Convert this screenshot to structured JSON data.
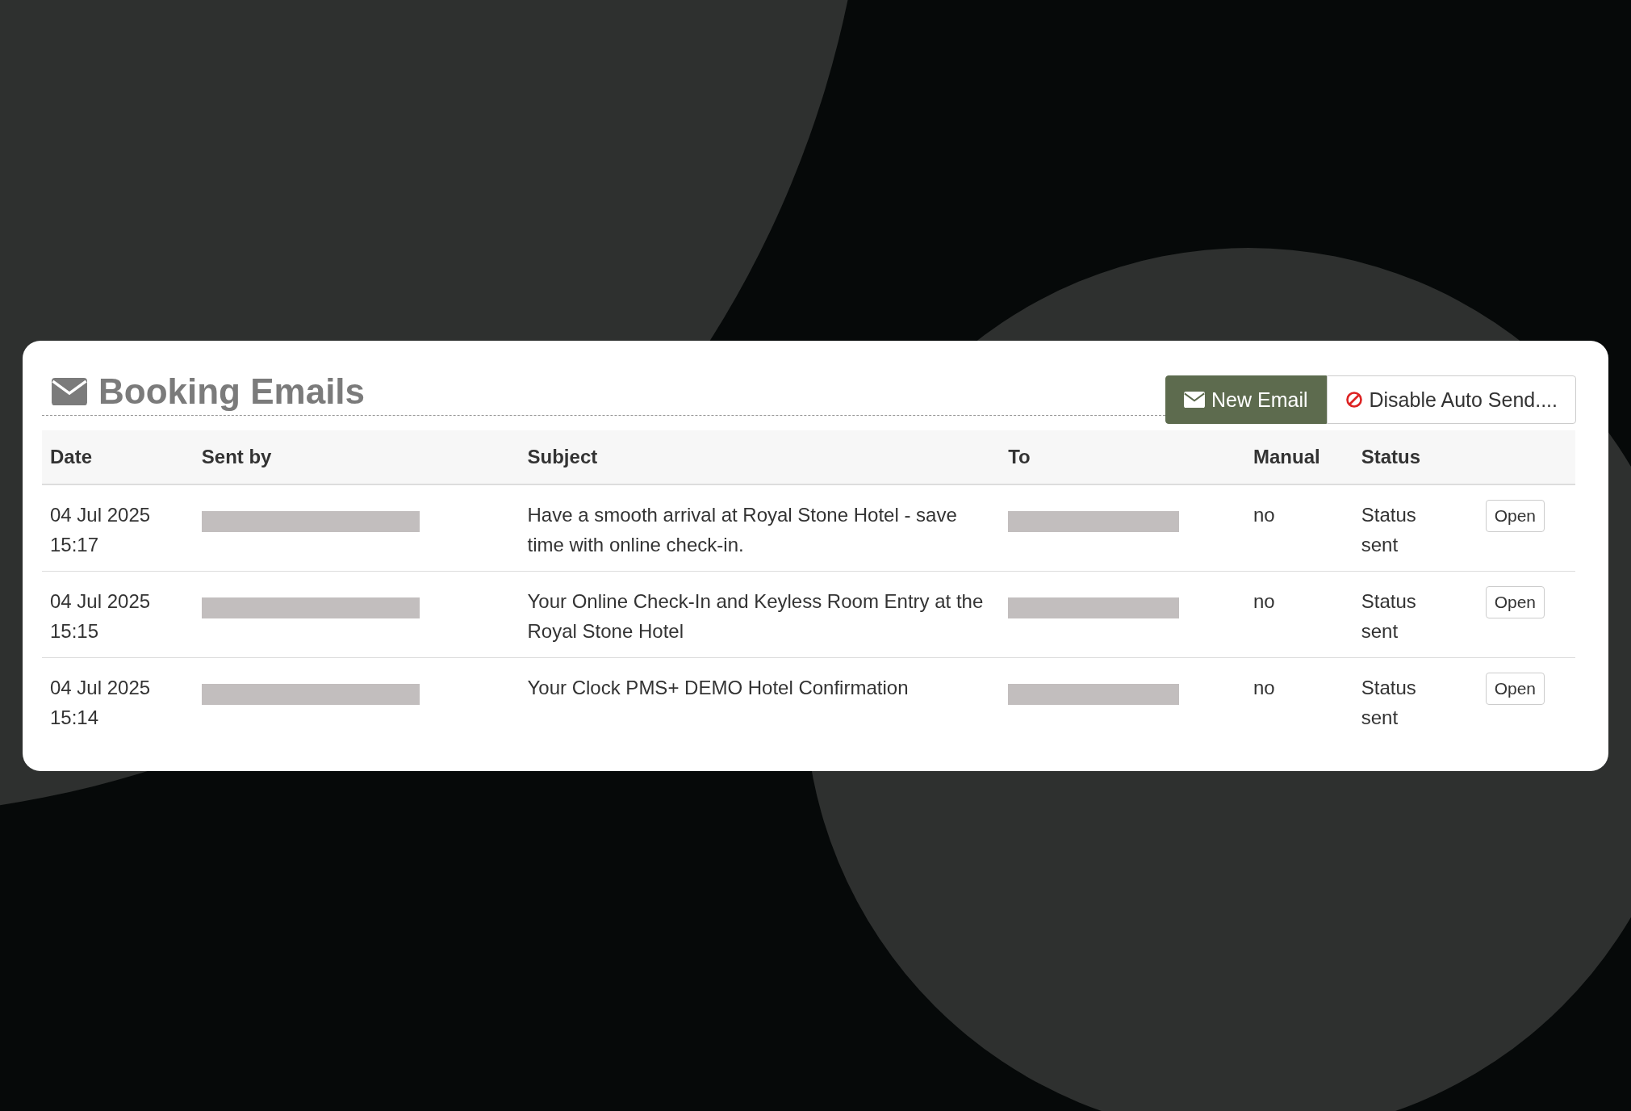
{
  "header": {
    "title": "Booking Emails",
    "buttons": [
      {
        "label": "New Email",
        "kind": "primary"
      },
      {
        "label": "Disable Auto Send....",
        "kind": "secondary"
      }
    ]
  },
  "table": {
    "columns": [
      "Date",
      "Sent by",
      "Subject",
      "To",
      "Manual",
      "Status"
    ],
    "rows": [
      {
        "date": "04 Jul 2025",
        "time": "15:17",
        "subject": "Have a smooth arrival at Royal Stone Hotel - save time with online check-in.",
        "manual": "no",
        "status": "Status sent",
        "action": "Open"
      },
      {
        "date": "04 Jul 2025",
        "time": "15:15",
        "subject": "Your Online Check-In and Keyless Room Entry at the Royal Stone Hotel",
        "manual": "no",
        "status": "Status sent",
        "action": "Open"
      },
      {
        "date": "04 Jul 2025",
        "time": "15:14",
        "subject": "Your Clock PMS+ DEMO Hotel Confirmation",
        "manual": "no",
        "status": "Status sent",
        "action": "Open"
      }
    ]
  }
}
